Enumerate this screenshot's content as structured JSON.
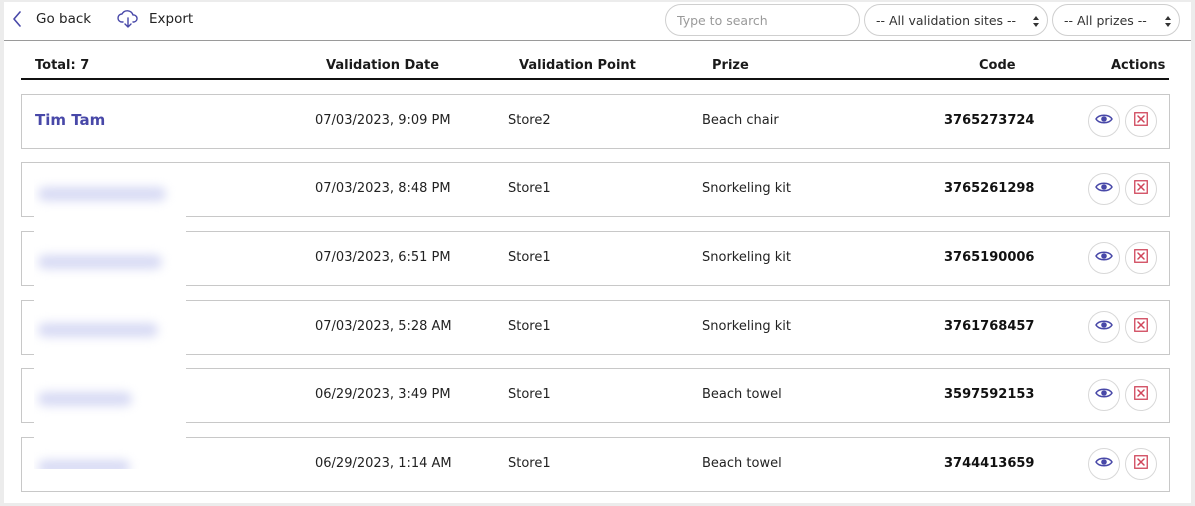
{
  "toolbar": {
    "back_label": "Go back",
    "export_label": "Export",
    "search_placeholder": "Type to search",
    "sites_select_value": "-- All validation sites --",
    "prizes_select_value": "-- All prizes --"
  },
  "table": {
    "headers": {
      "total": "Total: 7",
      "date": "Validation Date",
      "point": "Validation Point",
      "prize": "Prize",
      "code": "Code",
      "actions": "Actions"
    },
    "rows": [
      {
        "name": "Tim Tam",
        "date": "07/03/2023, 9:09 PM",
        "point": "Store2",
        "prize": "Beach chair",
        "code": "3765273724"
      },
      {
        "name": "",
        "date": "07/03/2023, 8:48 PM",
        "point": "Store1",
        "prize": "Snorkeling kit",
        "code": "3765261298"
      },
      {
        "name": "",
        "date": "07/03/2023, 6:51 PM",
        "point": "Store1",
        "prize": "Snorkeling kit",
        "code": "3765190006"
      },
      {
        "name": "",
        "date": "07/03/2023, 5:28 AM",
        "point": "Store1",
        "prize": "Snorkeling kit",
        "code": "3761768457"
      },
      {
        "name": "",
        "date": "06/29/2023, 3:49 PM",
        "point": "Store1",
        "prize": "Beach towel",
        "code": "3597592153"
      },
      {
        "name": "",
        "date": "06/29/2023, 1:14 AM",
        "point": "Store1",
        "prize": "Beach towel",
        "code": "3744413659"
      }
    ]
  },
  "icons": {
    "back": "chevron-left-icon",
    "export": "cloud-download-icon",
    "view": "eye-icon",
    "delete": "close-square-icon",
    "select_arrows": "sort-arrows-icon"
  },
  "colors": {
    "accent": "#4848a8",
    "delete_red": "#d0455a",
    "row_border": "#c8c8c8"
  }
}
